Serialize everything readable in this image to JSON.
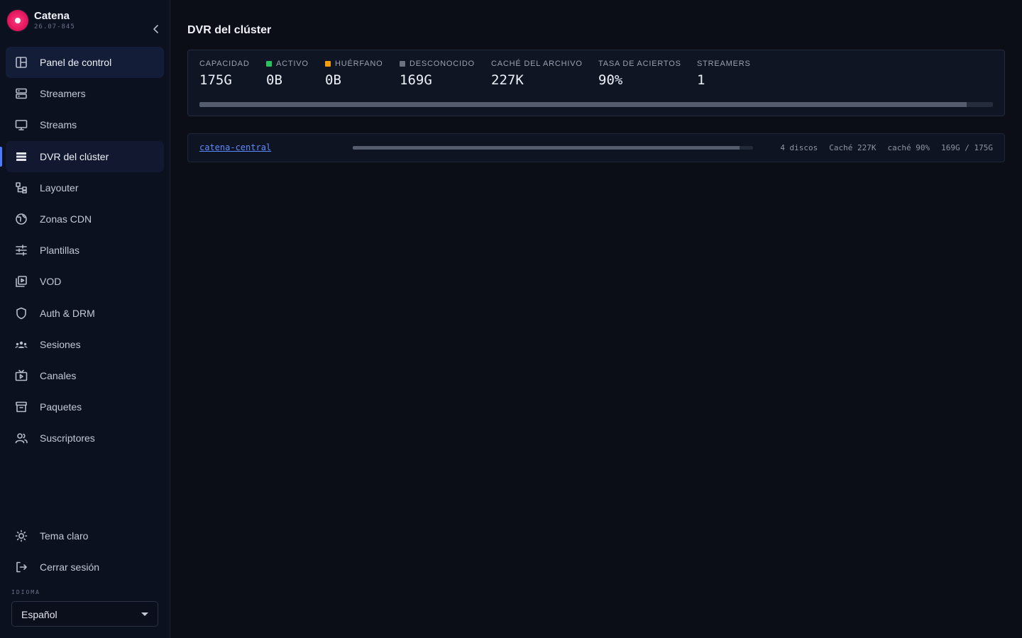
{
  "brand": {
    "name": "Catena",
    "version": "26.07-845"
  },
  "sidebar": {
    "items": [
      {
        "label": "Panel de control",
        "icon": "dashboard-icon"
      },
      {
        "label": "Streamers",
        "icon": "server-icon"
      },
      {
        "label": "Streams",
        "icon": "monitor-icon"
      },
      {
        "label": "DVR del clúster",
        "icon": "list-icon"
      },
      {
        "label": "Layouter",
        "icon": "layout-icon"
      },
      {
        "label": "Zonas CDN",
        "icon": "globe-icon"
      },
      {
        "label": "Plantillas",
        "icon": "sliders-icon"
      },
      {
        "label": "VOD",
        "icon": "video-library-icon"
      },
      {
        "label": "Auth & DRM",
        "icon": "shield-icon"
      },
      {
        "label": "Sesiones",
        "icon": "group-icon"
      },
      {
        "label": "Canales",
        "icon": "tv-icon"
      },
      {
        "label": "Paquetes",
        "icon": "archive-icon"
      },
      {
        "label": "Suscriptores",
        "icon": "users-icon"
      }
    ],
    "bottom": [
      {
        "label": "Tema claro",
        "icon": "sun-icon"
      },
      {
        "label": "Cerrar sesión",
        "icon": "logout-icon"
      }
    ],
    "language_label": "IDIOMA",
    "language_value": "Español"
  },
  "main": {
    "title": "DVR del clúster",
    "summary": {
      "stats": [
        {
          "label": "CAPACIDAD",
          "value": "175G",
          "dot": null
        },
        {
          "label": "ACTIVO",
          "value": "0B",
          "dot": "#22c55e"
        },
        {
          "label": "HUÉRFANO",
          "value": "0B",
          "dot": "#f59e0b"
        },
        {
          "label": "DESCONOCIDO",
          "value": "169G",
          "dot": "#6b7280"
        },
        {
          "label": "CACHÉ DEL ARCHIVO",
          "value": "227K",
          "dot": null
        },
        {
          "label": "TASA DE ACIERTOS",
          "value": "90%",
          "dot": null
        },
        {
          "label": "STREAMERS",
          "value": "1",
          "dot": null
        }
      ],
      "usage_fraction": 0.967
    },
    "nodes": [
      {
        "name": "catena-central",
        "usage_fraction": 0.967,
        "disks": "4 discos",
        "cache": "Caché 227K",
        "hit_rate": "caché 90%",
        "usage": "169G / 175G"
      }
    ]
  },
  "colors": {
    "accent": "#4d7cff",
    "link": "#5b8cff",
    "brand": "#e3175e"
  }
}
